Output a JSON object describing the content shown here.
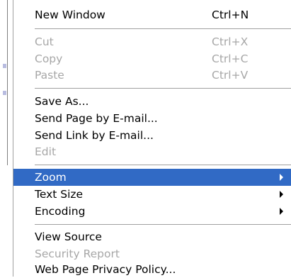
{
  "menu": {
    "items": [
      {
        "label": "New Window",
        "shortcut": "Ctrl+N"
      },
      {
        "label": "Cut",
        "shortcut": "Ctrl+X"
      },
      {
        "label": "Copy",
        "shortcut": "Ctrl+C"
      },
      {
        "label": "Paste",
        "shortcut": "Ctrl+V"
      },
      {
        "label": "Save As..."
      },
      {
        "label": "Send Page by E-mail..."
      },
      {
        "label": "Send Link by E-mail..."
      },
      {
        "label": "Edit"
      },
      {
        "label": "Zoom"
      },
      {
        "label": "Text Size"
      },
      {
        "label": "Encoding"
      },
      {
        "label": "View Source"
      },
      {
        "label": "Security Report"
      },
      {
        "label": "Web Page Privacy Policy..."
      }
    ]
  },
  "colors": {
    "highlight": "#316ac5",
    "disabled_text": "#a7a7a7",
    "separator": "#a0a0a0"
  }
}
